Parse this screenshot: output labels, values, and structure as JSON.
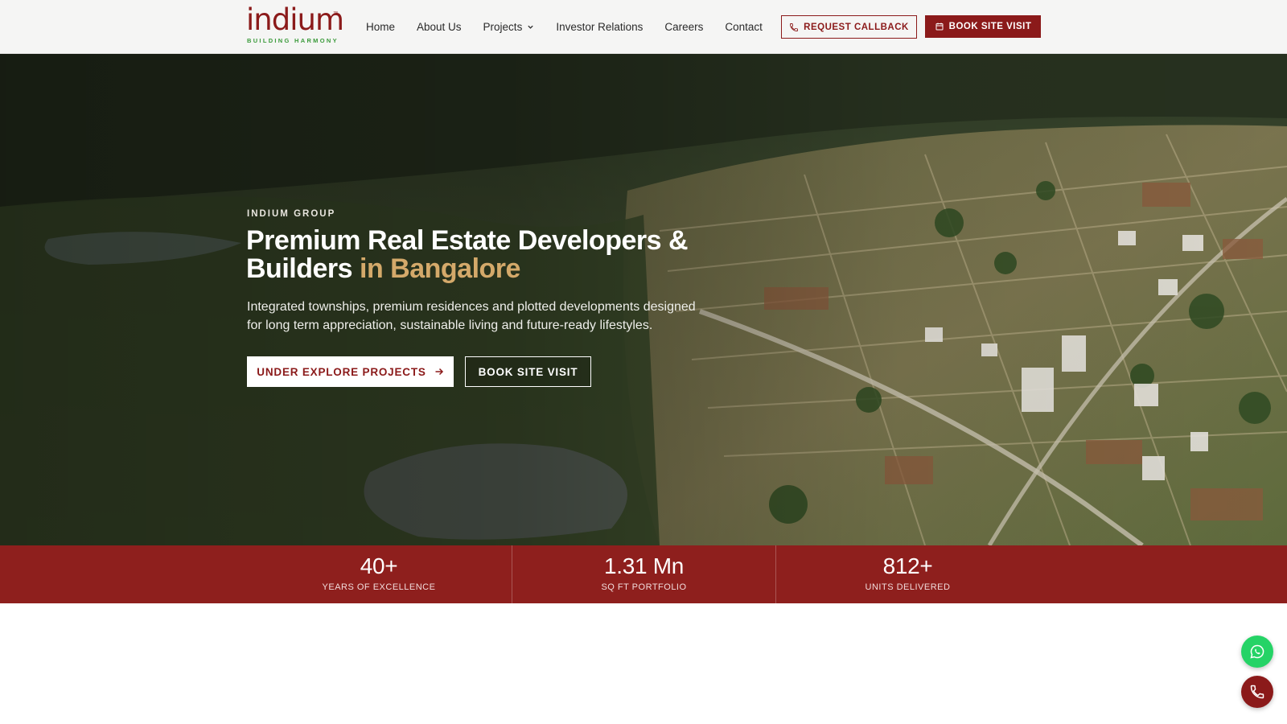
{
  "brand": {
    "name": "indium",
    "tagline": "BUILDING HARMONY",
    "trademark": "™"
  },
  "nav": {
    "items": [
      {
        "label": "Home"
      },
      {
        "label": "About Us"
      },
      {
        "label": "Projects",
        "has_dropdown": true
      },
      {
        "label": "Investor Relations"
      },
      {
        "label": "Careers"
      },
      {
        "label": "Contact"
      }
    ]
  },
  "header_actions": {
    "callback_label": "REQUEST CALLBACK",
    "callback_icon": "phone-icon",
    "book_label": "BOOK SITE VISIT",
    "book_icon": "calendar-icon"
  },
  "hero": {
    "eyebrow": "INDIUM GROUP",
    "headline_main": "Premium Real Estate Developers & Builders",
    "headline_accent": "in Bangalore",
    "subtext": "Integrated townships, premium residences and plotted developments designed for long term appreciation, sustainable living and future-ready lifestyles.",
    "primary_cta": "UNDER EXPLORE PROJECTS",
    "secondary_cta": "BOOK SITE VISIT"
  },
  "stats": [
    {
      "value": "40+",
      "label": "YEARS OF EXCELLENCE"
    },
    {
      "value": "1.31 Mn",
      "label": "SQ FT PORTFOLIO"
    },
    {
      "value": "812+",
      "label": "UNITS DELIVERED"
    }
  ],
  "floating": {
    "whatsapp_icon": "whatsapp-icon",
    "call_icon": "phone-icon"
  },
  "colors": {
    "brand_red": "#8b1a1a",
    "stats_bg": "#8e1f1d",
    "accent_gold": "#d4a96a",
    "tagline_green": "#3a9a3a",
    "whatsapp_green": "#25d366"
  }
}
